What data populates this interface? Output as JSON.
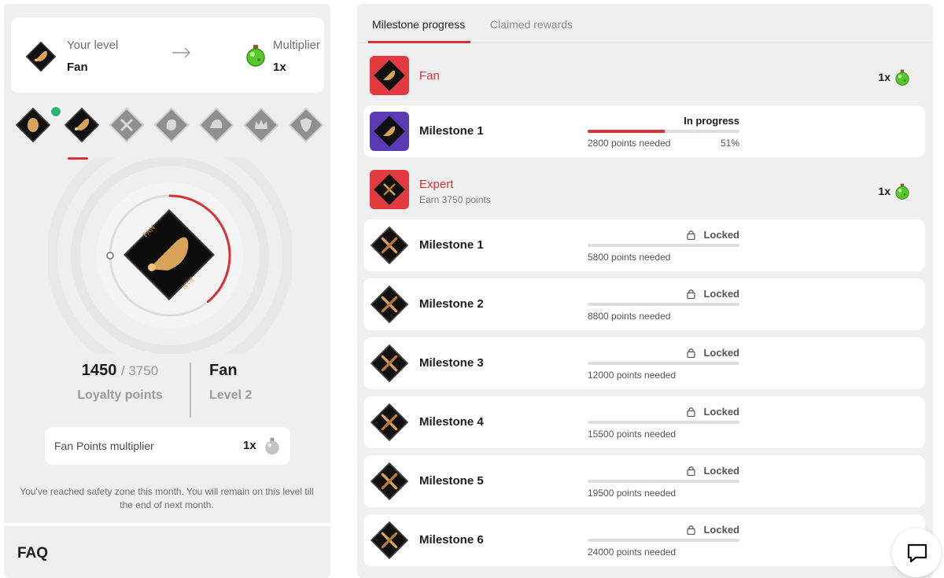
{
  "level_card": {
    "your_level_label": "Your level",
    "your_level_value": "Fan",
    "multiplier_label": "Multiplier",
    "multiplier_value": "1x"
  },
  "badges": [
    "egg",
    "fan",
    "expert",
    "glove",
    "cap",
    "crown",
    "shield"
  ],
  "progress_ring_fraction": 0.39,
  "loyalty": {
    "points": "1450",
    "max_points": "/ 3750",
    "points_label": "Loyalty points",
    "level_name": "Fan",
    "level_number": "Level 2"
  },
  "fan_points_multiplier": {
    "label": "Fan Points multiplier",
    "value": "1x"
  },
  "safety_text": "You've reached safety zone this month. You will remain on this level till the end of next month.",
  "faq": "FAQ",
  "tabs": {
    "active": "Milestone progress",
    "inactive": "Claimed rewards"
  },
  "levels": [
    {
      "title": "Fan",
      "subtitle": "",
      "multiplier": "1x",
      "milestones": [
        {
          "title": "Milestone 1",
          "status": "In progress",
          "needed": "2800 points needed",
          "percent": "51%",
          "progress": 0.51
        }
      ]
    },
    {
      "title": "Expert",
      "subtitle": "Earn 3750 points",
      "multiplier": "1x",
      "milestones": [
        {
          "title": "Milestone 1",
          "status": "Locked",
          "needed": "5800 points needed"
        },
        {
          "title": "Milestone 2",
          "status": "Locked",
          "needed": "8800 points needed"
        },
        {
          "title": "Milestone 3",
          "status": "Locked",
          "needed": "12000 points needed"
        },
        {
          "title": "Milestone 4",
          "status": "Locked",
          "needed": "15500 points needed"
        },
        {
          "title": "Milestone 5",
          "status": "Locked",
          "needed": "19500 points needed"
        },
        {
          "title": "Milestone 6",
          "status": "Locked",
          "needed": "24000 points needed"
        }
      ]
    }
  ],
  "colors": {
    "accent": "#d6323a",
    "fan_bg": "#e23b3f",
    "expert_bg": "#e23b3f",
    "milestone_bg": "#5b3bb3"
  }
}
